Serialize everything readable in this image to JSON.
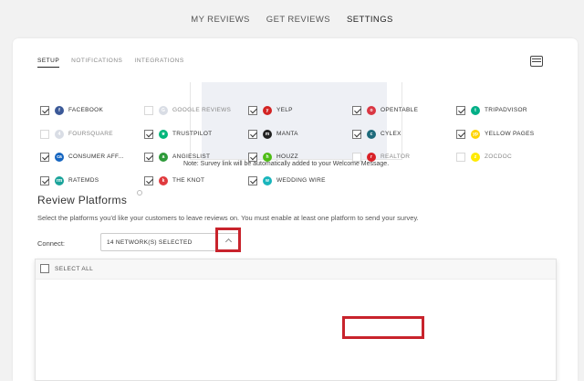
{
  "topnav": {
    "items": [
      {
        "label": "MY REVIEWS",
        "active": false
      },
      {
        "label": "GET REVIEWS",
        "active": false
      },
      {
        "label": "SETTINGS",
        "active": true
      }
    ]
  },
  "tabs": [
    {
      "label": "SETUP",
      "active": true
    },
    {
      "label": "NOTIFICATIONS",
      "active": false
    },
    {
      "label": "INTEGRATIONS",
      "active": false
    }
  ],
  "survey_note": "Note: Survey link will be automatically added to your Welcome Message.",
  "review_platforms": {
    "title": "Review Platforms",
    "description": "Select the platforms you'd like your customers to leave reviews on. You must enable at least one platform to send your survey.",
    "connect_label": "Connect:",
    "selected_value": "14 NETWORK(S) SELECTED"
  },
  "dropdown": {
    "select_all_label": "SELECT ALL",
    "platforms": [
      {
        "name": "FACEBOOK",
        "checked": true,
        "color": "#3b5998",
        "glyph": "f"
      },
      {
        "name": "GOOGLE REVIEWS",
        "checked": false,
        "color": "#d9dde5",
        "glyph": "G"
      },
      {
        "name": "YELP",
        "checked": true,
        "color": "#d32323",
        "glyph": "y"
      },
      {
        "name": "OPENTABLE",
        "checked": true,
        "color": "#da3743",
        "glyph": "o"
      },
      {
        "name": "TRIPADVISOR",
        "checked": true,
        "color": "#00af87",
        "glyph": "t"
      },
      {
        "name": "FOURSQUARE",
        "checked": false,
        "color": "#d9dde5",
        "glyph": "4"
      },
      {
        "name": "TRUSTPILOT",
        "checked": true,
        "color": "#00b67a",
        "glyph": "★"
      },
      {
        "name": "MANTA",
        "checked": true,
        "color": "#222222",
        "glyph": "m"
      },
      {
        "name": "CYLEX",
        "checked": true,
        "color": "#1e6a7b",
        "glyph": "c"
      },
      {
        "name": "YELLOW PAGES",
        "checked": true,
        "color": "#ffd400",
        "glyph": "yp"
      },
      {
        "name": "CONSUMER AFF...",
        "checked": true,
        "color": "#1565c0",
        "glyph": "ca"
      },
      {
        "name": "ANGIESLIST",
        "checked": true,
        "color": "#2e9a3a",
        "glyph": "a"
      },
      {
        "name": "HOUZZ",
        "checked": true,
        "color": "#4dbc15",
        "glyph": "h"
      },
      {
        "name": "REALTOR",
        "checked": false,
        "color": "#d92228",
        "glyph": "r"
      },
      {
        "name": "ZOCDOC",
        "checked": false,
        "color": "#ffea00",
        "glyph": "z"
      },
      {
        "name": "RATEMDS",
        "checked": true,
        "color": "#1aa39a",
        "glyph": "rm"
      },
      {
        "name": "THE KNOT",
        "checked": true,
        "color": "#e03a3e",
        "glyph": "k"
      },
      {
        "name": "WEDDING WIRE",
        "checked": true,
        "color": "#19b5bc",
        "glyph": "w"
      }
    ]
  }
}
